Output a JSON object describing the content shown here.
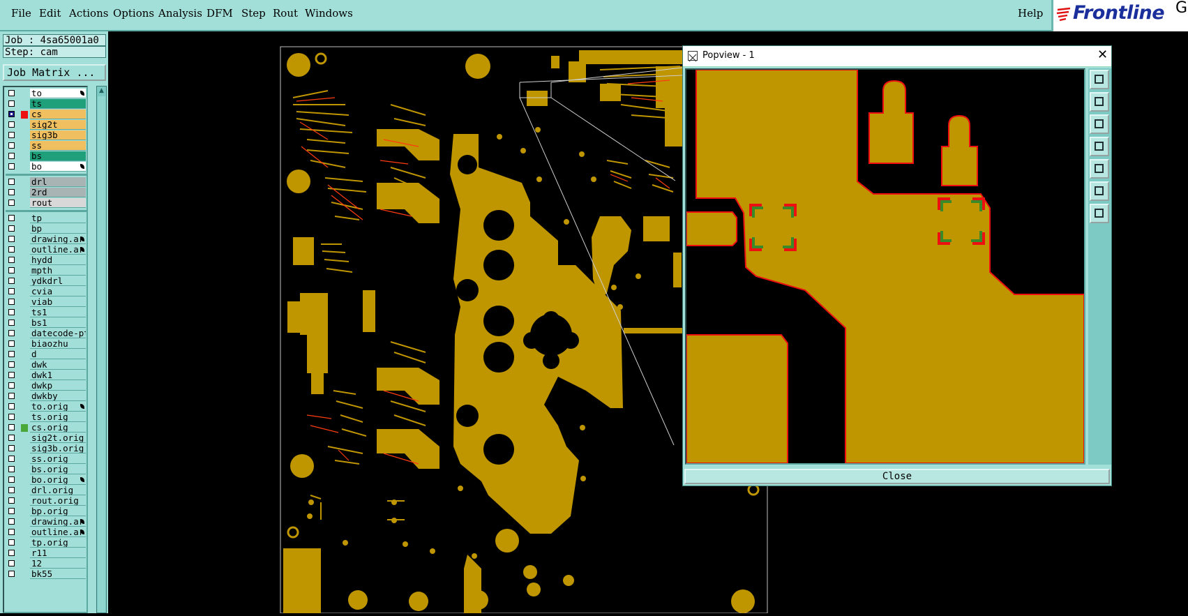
{
  "menubar": {
    "items": [
      "File",
      "Edit",
      "Actions",
      "Options",
      "Analysis",
      "DFM",
      "Step",
      "Rout",
      "Windows"
    ],
    "help": "Help",
    "logo_text": "Frontline",
    "logo_partial": "Ge"
  },
  "info": {
    "job": "Job : 4sa65001a0",
    "step": "Step: cam",
    "job_matrix": "Job Matrix ..."
  },
  "layers": {
    "board": [
      {
        "name": "to",
        "color": "#ffffff",
        "checked": false,
        "affected": true
      },
      {
        "name": "ts",
        "color": "#1f9f7a",
        "checked": false,
        "affected": false
      },
      {
        "name": "cs",
        "color": "#f0c060",
        "checked": true,
        "affected": false,
        "mark": "#ee1111"
      },
      {
        "name": "sig2t",
        "color": "#f0c060",
        "checked": false,
        "affected": false
      },
      {
        "name": "sig3b",
        "color": "#f0c060",
        "checked": false,
        "affected": false
      },
      {
        "name": "ss",
        "color": "#f0c060",
        "checked": false,
        "affected": false
      },
      {
        "name": "bs",
        "color": "#1f9f7a",
        "checked": false,
        "affected": false
      },
      {
        "name": "bo",
        "color": "#ffffff",
        "checked": false,
        "affected": true
      }
    ],
    "drill": [
      {
        "name": "drl",
        "color": "#a8b4b4",
        "checked": false,
        "affected": false
      },
      {
        "name": "2rd",
        "color": "#a8b4b4",
        "checked": false,
        "affected": false
      },
      {
        "name": "rout",
        "color": "#d8d8d8",
        "checked": false,
        "affected": false
      }
    ],
    "misc": [
      {
        "name": "tp",
        "affected": false
      },
      {
        "name": "bp",
        "affected": false
      },
      {
        "name": "drawing.ar",
        "affected": true
      },
      {
        "name": "outline.ar",
        "affected": true
      },
      {
        "name": "hydd",
        "affected": false
      },
      {
        "name": "mpth",
        "affected": false
      },
      {
        "name": "ydkdrl",
        "affected": false
      },
      {
        "name": "cvia",
        "affected": false
      },
      {
        "name": "viab",
        "affected": false
      },
      {
        "name": "ts1",
        "affected": false
      },
      {
        "name": "bs1",
        "affected": false
      },
      {
        "name": "datecode-pt",
        "affected": false
      },
      {
        "name": "biaozhu",
        "affected": false
      },
      {
        "name": "d",
        "affected": false
      },
      {
        "name": "dwk",
        "affected": false
      },
      {
        "name": "dwk1",
        "affected": false
      },
      {
        "name": "dwkp",
        "affected": false
      },
      {
        "name": "dwkby",
        "affected": false
      },
      {
        "name": "to.orig",
        "affected": true
      },
      {
        "name": "ts.orig",
        "affected": false
      },
      {
        "name": "cs.orig",
        "affected": false,
        "mark": "#4aa83a"
      },
      {
        "name": "sig2t.orig",
        "affected": false
      },
      {
        "name": "sig3b.orig",
        "affected": false
      },
      {
        "name": "ss.orig",
        "affected": false
      },
      {
        "name": "bs.orig",
        "affected": false
      },
      {
        "name": "bo.orig",
        "affected": true
      },
      {
        "name": "drl.orig",
        "affected": false
      },
      {
        "name": "rout.orig",
        "affected": false
      },
      {
        "name": "bp.orig",
        "affected": false
      },
      {
        "name": "drawing.ar",
        "affected": true
      },
      {
        "name": "outline.ar",
        "affected": true
      },
      {
        "name": "tp.orig",
        "affected": false
      },
      {
        "name": "r11",
        "affected": false
      },
      {
        "name": "12",
        "affected": false
      },
      {
        "name": "bk55",
        "affected": false
      }
    ],
    "misc_color": "#a3dfd9"
  },
  "popview": {
    "title": "Popview - 1",
    "close_label": "Close",
    "tools": [
      "zoom-window-icon",
      "zoom-in-icon",
      "zoom-out-icon",
      "pan-left-icon",
      "pan-right-icon",
      "fit-icon",
      "home-icon"
    ]
  },
  "colors": {
    "copper": "#bf9500",
    "outline_red": "#ee1010",
    "pad_green": "#3a8a2a",
    "panel_teal": "#a3dfd9"
  }
}
